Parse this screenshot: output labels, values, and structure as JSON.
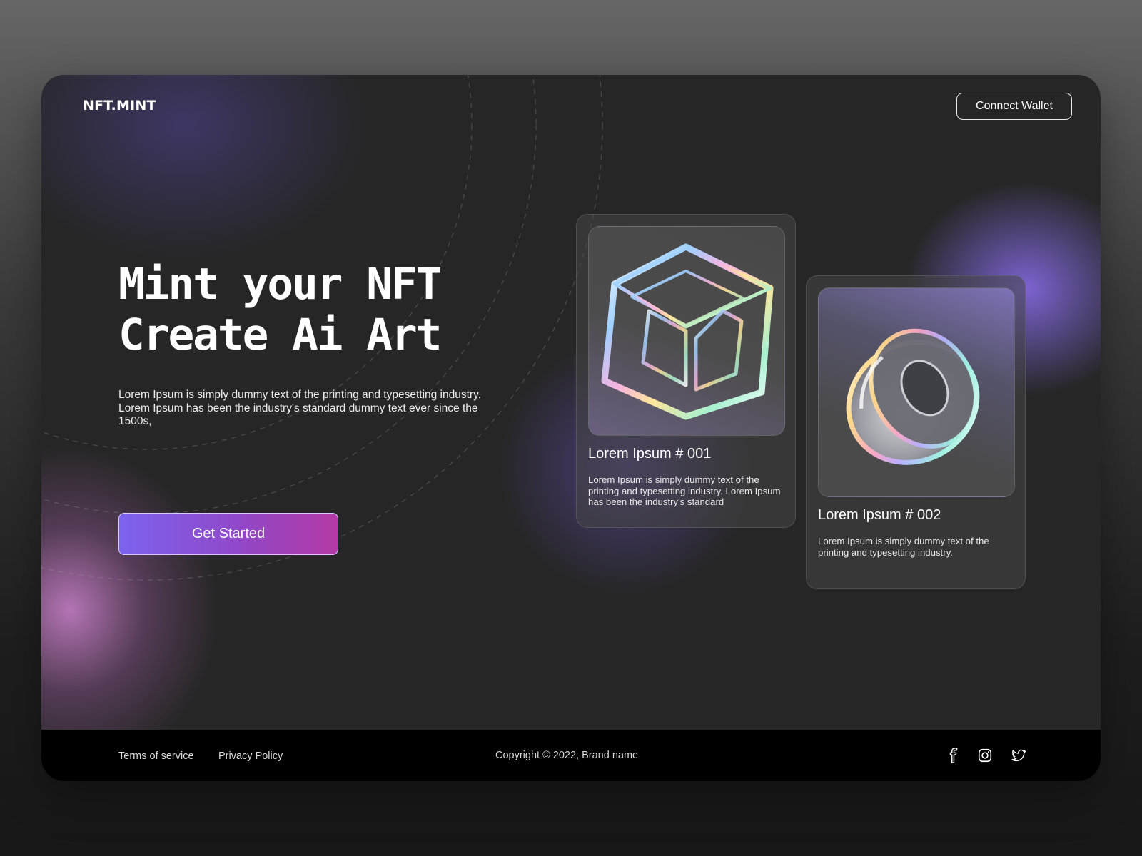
{
  "header": {
    "brand": "NFT.MINT",
    "connect_label": "Connect Wallet"
  },
  "hero": {
    "title_line1": "Mint your NFT",
    "title_line2": "Create Ai Art",
    "description": "Lorem Ipsum is simply dummy text of the printing and typesetting industry. Lorem Ipsum has been the industry's standard dummy text ever since the 1500s,",
    "cta_label": "Get Started"
  },
  "cards": [
    {
      "title": "Lorem Ipsum # 001",
      "description": "Lorem Ipsum is simply dummy text of the printing and typesetting industry. Lorem Ipsum has been the industry's standard",
      "image": "glass-cube-artwork"
    },
    {
      "title": "Lorem Ipsum # 002",
      "description": "Lorem Ipsum is simply dummy text of the printing and typesetting industry.",
      "image": "glass-torus-artwork"
    }
  ],
  "footer": {
    "terms": "Terms of service",
    "privacy": "Privacy Policy",
    "copyright": "Copyright © 2022, Brand name",
    "social": [
      "facebook-icon",
      "instagram-icon",
      "twitter-icon"
    ]
  },
  "colors": {
    "accent_start": "#7b63ee",
    "accent_end": "#b43aa6",
    "panel": "#262626",
    "footer": "#000000"
  }
}
